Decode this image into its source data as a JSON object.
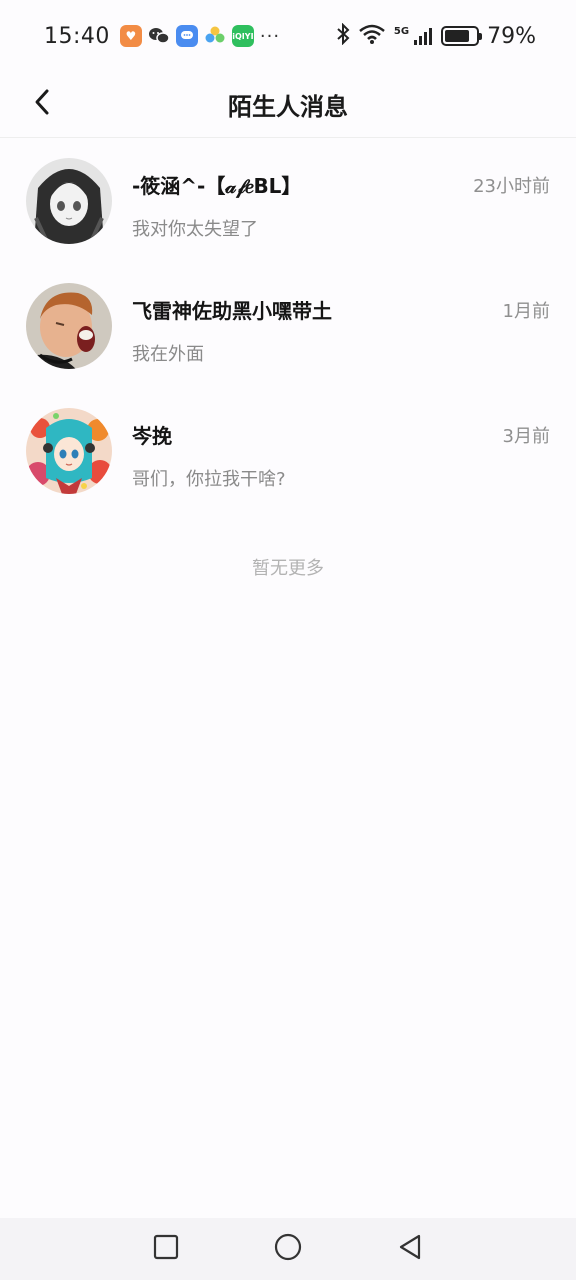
{
  "status_bar": {
    "time": "15:40",
    "app_icons": [
      "heart-app-icon",
      "wechat-icon",
      "message-app-icon",
      "photos-app-icon",
      "iqiyi-app-icon"
    ],
    "iqiyi_label": "iQIYI",
    "more": "···",
    "network": "5G",
    "battery_percent": 79,
    "battery_text": "79%"
  },
  "header": {
    "title": "陌生人消息",
    "back_icon": "chevron-left-icon"
  },
  "messages": [
    {
      "name": "-筱涵^-【𝒶𝒻𝑒BL】",
      "time": "23小时前",
      "preview": "我对你太失望了"
    },
    {
      "name": "飞雷神佐助黑小嘿带土",
      "time": "1月前",
      "preview": "我在外面"
    },
    {
      "name": "岑挽",
      "time": "3月前",
      "preview": "哥们，你拉我干啥?"
    }
  ],
  "footer_text": "暂无更多",
  "nav": {
    "recents_icon": "square-icon",
    "home_icon": "circle-icon",
    "back_icon": "triangle-back-icon"
  }
}
